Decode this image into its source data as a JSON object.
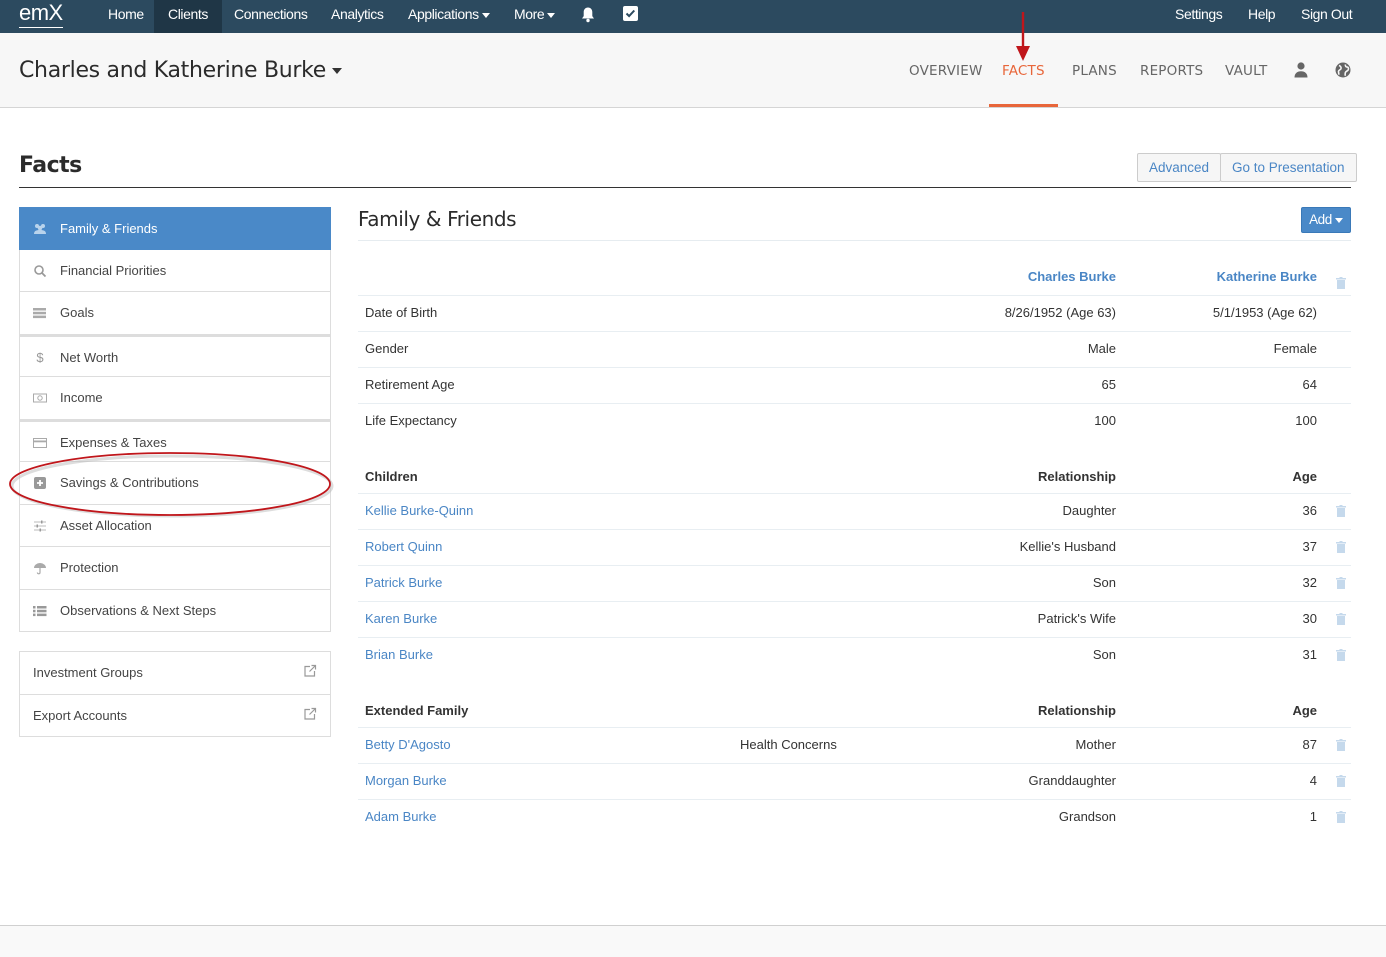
{
  "topnav": {
    "logo": "emX",
    "items": [
      {
        "label": "Home",
        "active": false
      },
      {
        "label": "Clients",
        "active": true
      },
      {
        "label": "Connections",
        "active": false
      },
      {
        "label": "Analytics",
        "active": false
      },
      {
        "label": "Applications",
        "dropdown": true
      },
      {
        "label": "More",
        "dropdown": true
      }
    ],
    "icons": [
      "bell-icon",
      "checkbox-icon"
    ],
    "right_items": [
      "Settings",
      "Help",
      "Sign Out"
    ]
  },
  "client": {
    "name": "Charles and Katherine Burke",
    "tabs": [
      {
        "label": "OVERVIEW",
        "active": false
      },
      {
        "label": "FACTS",
        "active": true
      },
      {
        "label": "PLANS",
        "active": false
      },
      {
        "label": "REPORTS",
        "active": false
      },
      {
        "label": "VAULT",
        "active": false
      }
    ],
    "icons": [
      "user-icon",
      "globe-icon"
    ]
  },
  "page": {
    "title": "Facts",
    "buttons": {
      "advanced": "Advanced",
      "presentation": "Go to Presentation"
    }
  },
  "sidebar": {
    "items": [
      {
        "label": "Family & Friends",
        "icon": "users-icon",
        "active": true
      },
      {
        "label": "Financial Priorities",
        "icon": "search-icon"
      },
      {
        "label": "Goals",
        "icon": "list-icon"
      },
      {
        "label": "Net Worth",
        "icon": "dollar-icon"
      },
      {
        "label": "Income",
        "icon": "money-icon"
      },
      {
        "label": "Expenses & Taxes",
        "icon": "credit-card-icon"
      },
      {
        "label": "Savings & Contributions",
        "icon": "plus-square-icon"
      },
      {
        "label": "Asset Allocation",
        "icon": "sliders-icon"
      },
      {
        "label": "Protection",
        "icon": "umbrella-icon"
      },
      {
        "label": "Observations & Next Steps",
        "icon": "list-ul-icon"
      }
    ],
    "links": [
      {
        "label": "Investment Groups",
        "icon": "external-link-icon"
      },
      {
        "label": "Export Accounts",
        "icon": "external-link-icon"
      }
    ]
  },
  "main": {
    "title": "Family & Friends",
    "add_label": "Add",
    "clients": {
      "columns": [
        "Charles Burke",
        "Katherine Burke"
      ],
      "rows": [
        {
          "label": "Date of Birth",
          "values": [
            "8/26/1952 (Age 63)",
            "5/1/1953 (Age 62)"
          ]
        },
        {
          "label": "Gender",
          "values": [
            "Male",
            "Female"
          ]
        },
        {
          "label": "Retirement Age",
          "values": [
            "65",
            "64"
          ]
        },
        {
          "label": "Life Expectancy",
          "values": [
            "100",
            "100"
          ]
        }
      ]
    },
    "children": {
      "header": {
        "name": "Children",
        "relationship": "Relationship",
        "age": "Age"
      },
      "rows": [
        {
          "name": "Kellie Burke-Quinn",
          "relationship": "Daughter",
          "age": "36"
        },
        {
          "name": "Robert Quinn",
          "relationship": "Kellie's Husband",
          "age": "37"
        },
        {
          "name": "Patrick Burke",
          "relationship": "Son",
          "age": "32"
        },
        {
          "name": "Karen Burke",
          "relationship": "Patrick's Wife",
          "age": "30"
        },
        {
          "name": "Brian Burke",
          "relationship": "Son",
          "age": "31"
        }
      ]
    },
    "extended": {
      "header": {
        "name": "Extended Family",
        "relationship": "Relationship",
        "age": "Age"
      },
      "rows": [
        {
          "name": "Betty D'Agosto",
          "note": "Health Concerns",
          "relationship": "Mother",
          "age": "87"
        },
        {
          "name": "Morgan Burke",
          "note": "",
          "relationship": "Granddaughter",
          "age": "4"
        },
        {
          "name": "Adam Burke",
          "note": "",
          "relationship": "Grandson",
          "age": "1"
        }
      ]
    }
  },
  "colors": {
    "nav_bg": "#2c4a5f",
    "accent_orange": "#e8663a",
    "primary_blue": "#4a89c8",
    "link_blue": "#4a86c5",
    "annotation_red": "#c0161b"
  }
}
